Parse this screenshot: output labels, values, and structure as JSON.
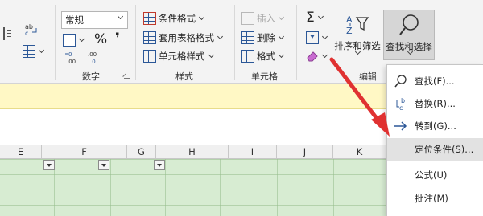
{
  "ribbon": {
    "partial_top_labels": [
      "…",
      "…",
      "…"
    ],
    "number_group": {
      "label": "数字",
      "format_value": "常规",
      "percent_symbol": "%",
      "comma_symbol": "❜",
      "increase_decimal": "←.0\n.00",
      "decrease_decimal": ".00\n→.0"
    },
    "styles_group": {
      "label": "样式",
      "conditional_format": "条件格式",
      "format_as_table": "套用表格格式",
      "cell_styles": "单元格样式"
    },
    "cells_group": {
      "label": "单元格",
      "insert": "插入",
      "delete": "删除",
      "format": "格式"
    },
    "editing_group": {
      "label": "编辑",
      "sort_filter": "排序和筛选",
      "find_select": "查找和选择"
    }
  },
  "sheet": {
    "columns": [
      "E",
      "F",
      "G",
      "H",
      "I",
      "J",
      "K"
    ]
  },
  "menu": {
    "items": [
      {
        "label": "查找(F)...",
        "icon": "search-icon"
      },
      {
        "label": "替换(R)...",
        "icon": "replace-icon"
      },
      {
        "label": "转到(G)...",
        "icon": "arrow-right-icon"
      },
      {
        "label": "定位条件(S)...",
        "icon": "none",
        "highlighted": true
      },
      {
        "label": "公式(U)",
        "icon": "none"
      },
      {
        "label": "批注(M)",
        "icon": "none"
      }
    ]
  },
  "colors": {
    "accent_blue": "#2b5797",
    "arrow_red": "#e03131",
    "sheet_fill": "#d7ecd2",
    "infobar_yellow": "#fff8c5"
  }
}
